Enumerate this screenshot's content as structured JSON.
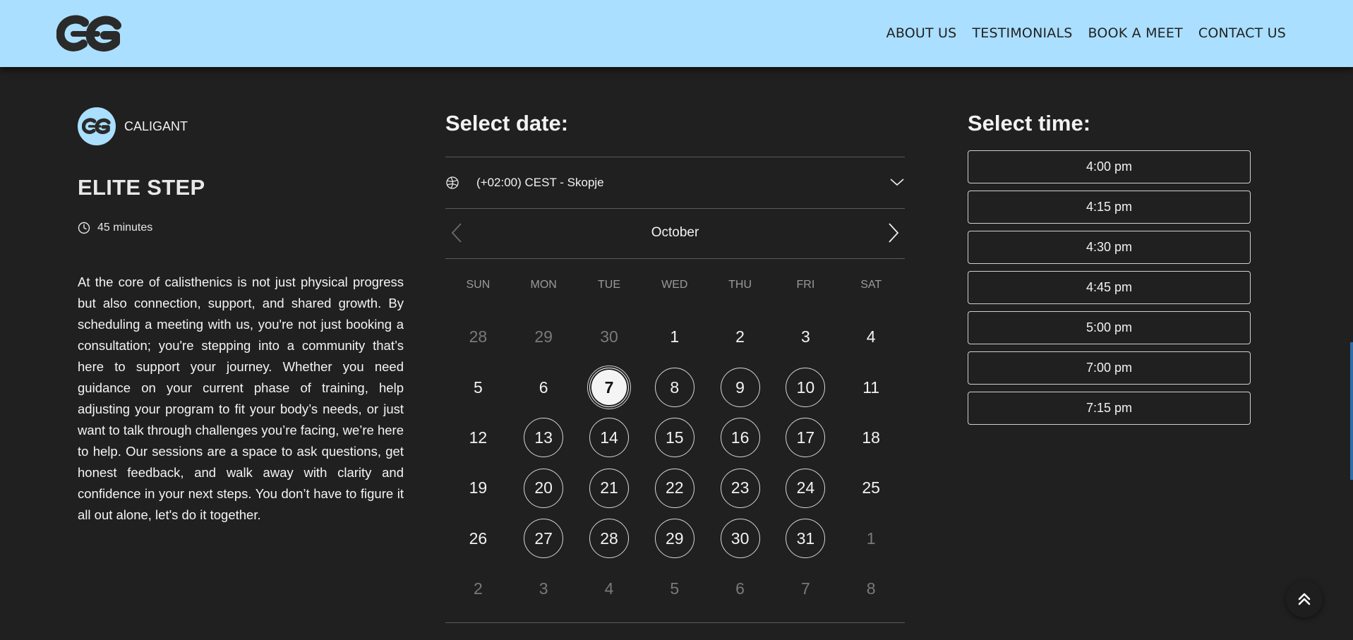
{
  "header": {
    "logo_icon": "cg-logo-icon",
    "nav": [
      {
        "label": "ABOUT US"
      },
      {
        "label": "TESTIMONIALS"
      },
      {
        "label": "BOOK A MEET"
      },
      {
        "label": "CONTACT US"
      }
    ],
    "colors": {
      "bar": "#aadfff",
      "background": "#202020"
    }
  },
  "host": {
    "name": "CALIGANT",
    "badge_icon": "cg-logo-icon"
  },
  "event": {
    "title": "ELITE STEP",
    "duration_icon": "clock-icon",
    "duration": "45 minutes",
    "description": "At the core of calisthenics is not just physical progress but also connection, support, and shared growth. By scheduling a meeting with us, you're not just booking a consultation; you're stepping into a community that’s here to support your journey. Whether you need guidance on your current phase of training, help adjusting your program to fit your body’s needs, or just want to talk through challenges you’re facing, we’re here to help. Our sessions are a space to ask questions, get honest feedback, and walk away with clarity and confidence in your next steps. You don’t have to figure it all out alone, let's do it together."
  },
  "calendar": {
    "heading": "Select date:",
    "timezone": "(+02:00) CEST - Skopje",
    "month": "October",
    "weekdays": [
      "SUN",
      "MON",
      "TUE",
      "WED",
      "THU",
      "FRI",
      "SAT"
    ],
    "days": [
      {
        "n": "28",
        "state": "muted"
      },
      {
        "n": "29",
        "state": "muted"
      },
      {
        "n": "30",
        "state": "muted"
      },
      {
        "n": "1",
        "state": "plain"
      },
      {
        "n": "2",
        "state": "plain"
      },
      {
        "n": "3",
        "state": "plain"
      },
      {
        "n": "4",
        "state": "plain"
      },
      {
        "n": "5",
        "state": "plain"
      },
      {
        "n": "6",
        "state": "plain"
      },
      {
        "n": "7",
        "state": "selected"
      },
      {
        "n": "8",
        "state": "avail"
      },
      {
        "n": "9",
        "state": "avail"
      },
      {
        "n": "10",
        "state": "avail"
      },
      {
        "n": "11",
        "state": "plain"
      },
      {
        "n": "12",
        "state": "plain"
      },
      {
        "n": "13",
        "state": "avail"
      },
      {
        "n": "14",
        "state": "avail"
      },
      {
        "n": "15",
        "state": "avail"
      },
      {
        "n": "16",
        "state": "avail"
      },
      {
        "n": "17",
        "state": "avail"
      },
      {
        "n": "18",
        "state": "plain"
      },
      {
        "n": "19",
        "state": "plain"
      },
      {
        "n": "20",
        "state": "avail"
      },
      {
        "n": "21",
        "state": "avail"
      },
      {
        "n": "22",
        "state": "avail"
      },
      {
        "n": "23",
        "state": "avail"
      },
      {
        "n": "24",
        "state": "avail"
      },
      {
        "n": "25",
        "state": "plain"
      },
      {
        "n": "26",
        "state": "plain"
      },
      {
        "n": "27",
        "state": "avail"
      },
      {
        "n": "28",
        "state": "avail"
      },
      {
        "n": "29",
        "state": "avail"
      },
      {
        "n": "30",
        "state": "avail"
      },
      {
        "n": "31",
        "state": "avail"
      },
      {
        "n": "1",
        "state": "muted"
      },
      {
        "n": "2",
        "state": "muted"
      },
      {
        "n": "3",
        "state": "muted"
      },
      {
        "n": "4",
        "state": "muted"
      },
      {
        "n": "5",
        "state": "muted"
      },
      {
        "n": "6",
        "state": "muted"
      },
      {
        "n": "7",
        "state": "muted"
      },
      {
        "n": "8",
        "state": "muted"
      }
    ]
  },
  "times": {
    "heading": "Select time:",
    "slots": [
      "4:00 pm",
      "4:15 pm",
      "4:30 pm",
      "4:45 pm",
      "5:00 pm",
      "7:00 pm",
      "7:15 pm"
    ]
  }
}
